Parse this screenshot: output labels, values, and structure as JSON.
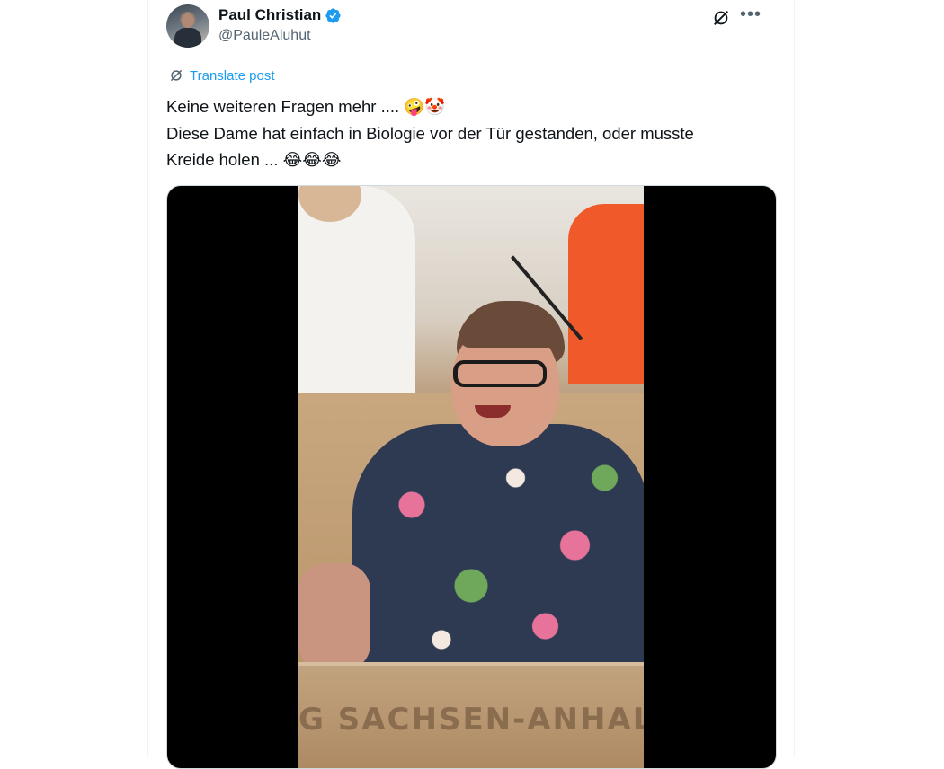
{
  "tweet": {
    "author": {
      "display_name": "Paul Christian",
      "handle": "@PauleAluhut",
      "verified": true
    },
    "translate_label": "Translate post",
    "text_lines": [
      "Keine weiteren Fragen mehr .... 🤪🤡",
      "Diese Dame hat einfach in Biologie vor der Tür gestanden, oder musste",
      "Kreide holen ... 😂😂😂"
    ],
    "media": {
      "type": "video",
      "podium_text": "G SACHSEN-ANHALT"
    },
    "icons": {
      "verified": "verified-badge-icon",
      "grok": "grok-icon",
      "more": "more-icon",
      "translate": "translate-icon"
    },
    "colors": {
      "accent": "#1d9bf0",
      "secondary_text": "#536471",
      "primary_text": "#0f1419"
    }
  }
}
